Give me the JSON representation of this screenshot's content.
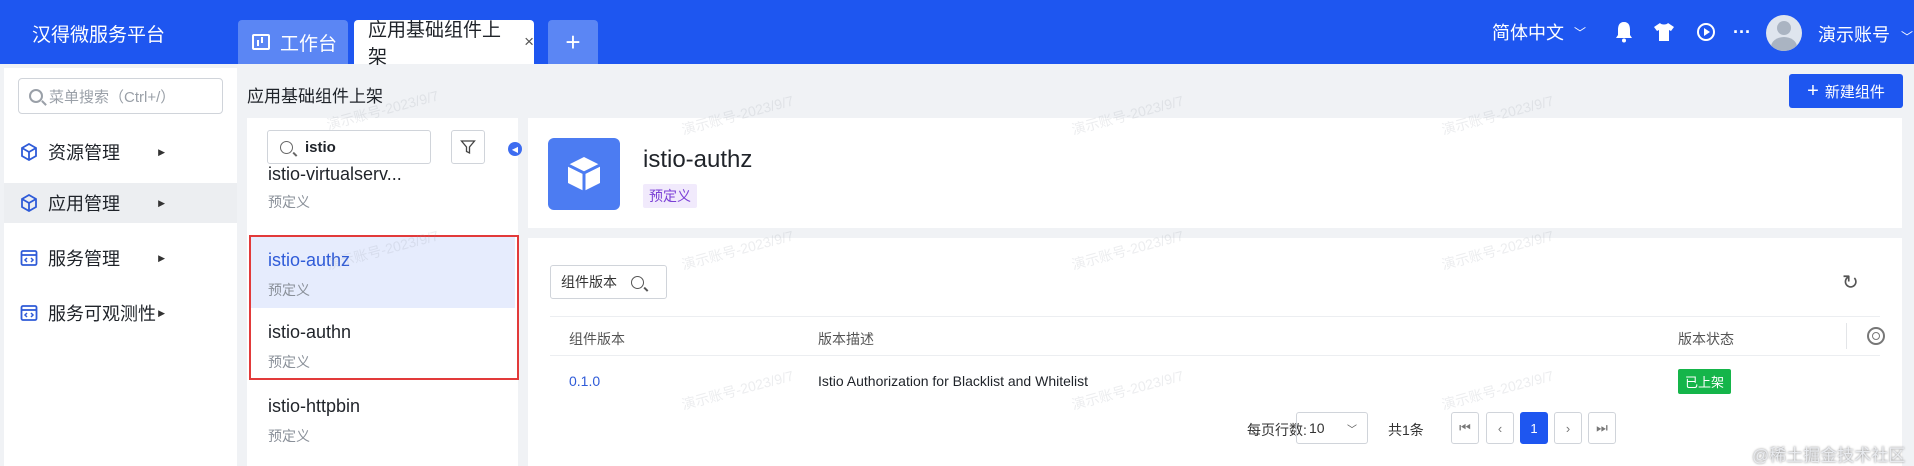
{
  "header": {
    "brand": "汉得微服务平台",
    "tabs": [
      {
        "label": "工作台"
      },
      {
        "label": "应用基础组件上架",
        "close": "×"
      },
      {
        "label": "+"
      }
    ],
    "language": "简体中文",
    "username": "演示账号",
    "more": "···"
  },
  "sidebar": {
    "search_placeholder": "菜单搜索（Ctrl+/）",
    "items": [
      {
        "label": "资源管理"
      },
      {
        "label": "应用管理"
      },
      {
        "label": "服务管理"
      },
      {
        "label": "服务可观测性"
      }
    ]
  },
  "page": {
    "title": "应用基础组件上架",
    "new_button": "新建组件"
  },
  "component_list": {
    "search_value": "istio",
    "items": [
      {
        "name": "istio-virtualserv...",
        "tag": "预定义"
      },
      {
        "name": "istio-authz",
        "tag": "预定义"
      },
      {
        "name": "istio-authn",
        "tag": "预定义"
      },
      {
        "name": "istio-httpbin",
        "tag": "预定义"
      }
    ]
  },
  "detail": {
    "name": "istio-authz",
    "tag": "预定义"
  },
  "versions": {
    "filter_label": "组件版本",
    "columns": [
      "组件版本",
      "版本描述",
      "版本状态"
    ],
    "rows": [
      {
        "version": "0.1.0",
        "description": "Istio Authorization for Blacklist and Whitelist",
        "status": "已上架"
      }
    ],
    "pagination": {
      "rows_per_page_label": "每页行数:",
      "rows_per_page": "10",
      "total": "共1条",
      "current_page": "1"
    }
  },
  "watermark": "演示账号-2023/9/7",
  "site_mark": "@稀土掘金技术社区"
}
